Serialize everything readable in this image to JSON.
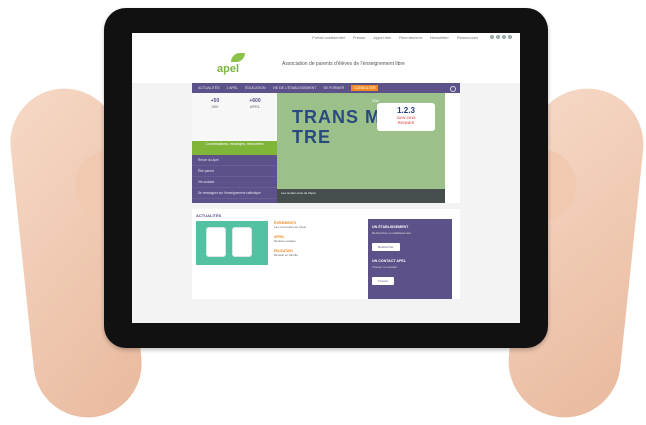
{
  "site": {
    "toplinks": [
      "Portail confidentiel",
      "Presse",
      "Appel des",
      "Recrutement",
      "Newsletter",
      "Ressources"
    ],
    "logo_text": "apel",
    "tagline": "Association de parents d'élèves de l'enseignement libre"
  },
  "nav": {
    "items": [
      "ACTUALITÉS",
      "L'APEL",
      "ÉDUCATION",
      "VIE DE L'ÉTABLISSEMENT",
      "SE FORMER"
    ],
    "highlight": "CONSULTER"
  },
  "left": {
    "stat1_value": "+50",
    "stat1_label": "000",
    "stat2_value": "+600",
    "stat2_label": "APEL",
    "green_button": "Conversations, échanges, rencontres",
    "list": [
      "Revue du Apel",
      "Être parent",
      "Vie scolaire",
      "Se renseigner sur l'enseignement catholique"
    ]
  },
  "hero": {
    "top_small": "20e",
    "main_word": "TRANS MET TRE",
    "date": "1.2.3",
    "date_sub": "JUIN 2018",
    "city": "RENNES",
    "foot": "Les rendez-vous de l'Apel"
  },
  "bottom": {
    "actualites_title": "ACTUALITÉS",
    "news": [
      {
        "title": "ÉVÉNEMENTS",
        "text": "Les rencontres de l'Apel"
      },
      {
        "title": "APPEL",
        "text": "Rentrée scolaire"
      },
      {
        "title": "ÉDUCATION",
        "text": "Réussir en famille"
      }
    ],
    "sidebar": {
      "title1": "UN ÉTABLISSEMENT",
      "body1": "Rechercher un établissement",
      "btn1": "Rechercher",
      "title2": "UN CONTACT APEL",
      "body2": "Trouver un contact",
      "btn2": "Trouver"
    }
  }
}
